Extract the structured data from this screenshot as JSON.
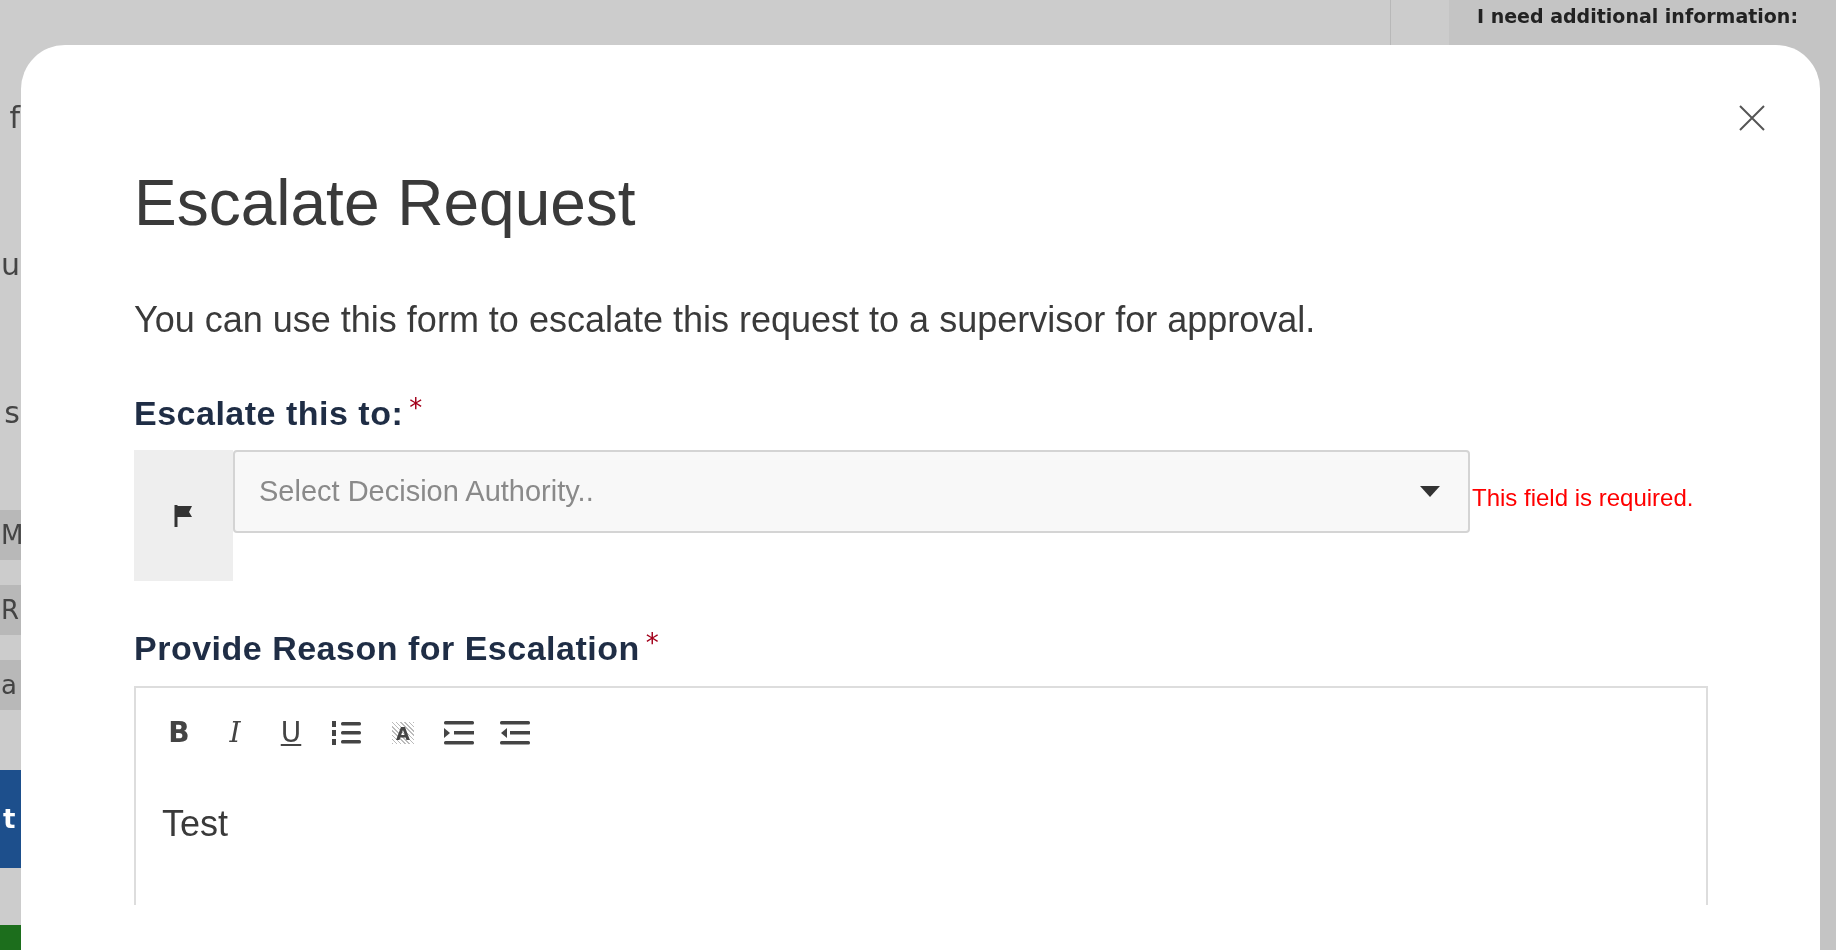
{
  "background": {
    "left_fragments": [
      {
        "kind": "text",
        "text": "f"
      },
      {
        "kind": "text",
        "text": "u"
      },
      {
        "kind": "text",
        "text": "s"
      },
      {
        "kind": "chip",
        "text": "M"
      },
      {
        "kind": "chip",
        "text": "R"
      },
      {
        "kind": "chip",
        "text": "a"
      },
      {
        "kind": "button",
        "text": "t"
      }
    ],
    "right_header": "I need additional information:"
  },
  "dialog": {
    "title": "Escalate Request",
    "description": "You can use this form to escalate this request to a supervisor for approval.",
    "fields": [
      {
        "kind": "select",
        "label": "Escalate this to:",
        "required_mark": "*",
        "placeholder": "Select Decision Authority..",
        "error": "This field is required."
      },
      {
        "kind": "editor",
        "label": "Provide Reason for Escalation",
        "required_mark": "*",
        "toolbar": [
          {
            "kind": "bold",
            "glyph": "B"
          },
          {
            "kind": "italic",
            "glyph": "I"
          },
          {
            "kind": "underline",
            "glyph": "U"
          },
          {
            "kind": "numbered-list"
          },
          {
            "kind": "highlight",
            "glyph": "A"
          },
          {
            "kind": "indent"
          },
          {
            "kind": "outdent"
          }
        ],
        "value": "Test"
      }
    ]
  }
}
